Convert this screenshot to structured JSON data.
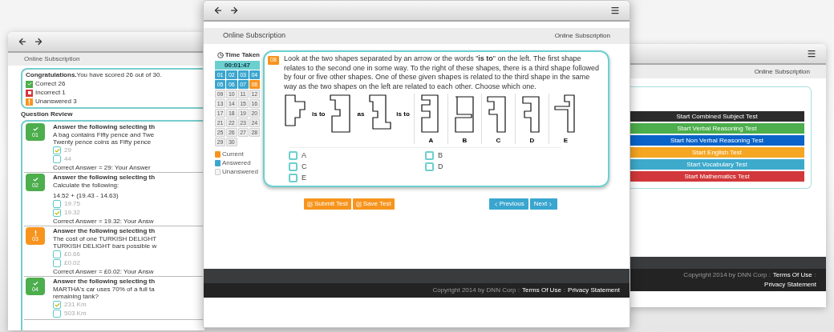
{
  "left_window": {
    "subheader": "Online Subscription",
    "result": {
      "message": "**Congratulations.**You have scored 26 out of 30.",
      "tallies": [
        {
          "kind": "correct",
          "label": "Correct 26"
        },
        {
          "kind": "incorrect",
          "label": "Incorrect 1"
        },
        {
          "kind": "unanswered",
          "label": "Unanswered 3"
        }
      ]
    },
    "review_title": "Question Review",
    "questions": [
      {
        "kind": "correct",
        "number": "01",
        "title": "Answer the following selecting th",
        "lines": [
          "A bag contains Fifty pence and Twe",
          "Twenty pence coins as Fifty pence"
        ],
        "options": [
          {
            "label": "29",
            "checked": true
          },
          {
            "label": "44",
            "checked": false
          }
        ],
        "answer": "Correct Answer = 29: Your Answer"
      },
      {
        "kind": "correct",
        "number": "02",
        "title": "Answer the following selecting th",
        "lines": [
          "Calculate the following:",
          "14.52 + (19.43 - 14.63)"
        ],
        "options": [
          {
            "label": "19.75",
            "checked": false
          },
          {
            "label": "19.32",
            "checked": true
          }
        ],
        "answer": "Correct Answer = 19.32: Your Answ"
      },
      {
        "kind": "unanswered",
        "number": "03",
        "title": "Answer the following selecting th",
        "lines": [
          "The cost of one TURKISH DELIGHT",
          "TURKISH DELIGHT bars possible w"
        ],
        "options": [
          {
            "label": "£0.66",
            "checked": false
          },
          {
            "label": "£0.02",
            "checked": false
          }
        ],
        "answer": "Correct Answer = £0.02: Your Answ"
      },
      {
        "kind": "correct",
        "number": "04",
        "title": "Answer the following selecting th",
        "lines": [
          "MARTHA's car uses 70% of a full ta",
          "remaining tank?"
        ],
        "options": [
          {
            "label": "231 Km",
            "checked": true
          },
          {
            "label": "503 Km",
            "checked": false
          }
        ]
      }
    ]
  },
  "main_window": {
    "subheader": "Online Subscription",
    "subheader_right": "Online Subscription",
    "timer": {
      "label": "Time Taken",
      "value": "00:01:47"
    },
    "question_nav": [
      {
        "number": "01",
        "answered": true,
        "current": false
      },
      {
        "number": "02",
        "answered": true,
        "current": false
      },
      {
        "number": "03",
        "answered": true,
        "current": false
      },
      {
        "number": "04",
        "answered": true,
        "current": false
      },
      {
        "number": "05",
        "answered": true,
        "current": false
      },
      {
        "number": "06",
        "answered": true,
        "current": false
      },
      {
        "number": "07",
        "answered": true,
        "current": false
      },
      {
        "number": "08",
        "answered": false,
        "current": true
      },
      {
        "number": "09",
        "answered": false,
        "current": false
      },
      {
        "number": "10",
        "answered": false,
        "current": false
      },
      {
        "number": "11",
        "answered": false,
        "current": false
      },
      {
        "number": "12",
        "answered": false,
        "current": false
      },
      {
        "number": "13",
        "answered": false,
        "current": false
      },
      {
        "number": "14",
        "answered": false,
        "current": false
      },
      {
        "number": "15",
        "answered": false,
        "current": false
      },
      {
        "number": "16",
        "answered": false,
        "current": false
      },
      {
        "number": "17",
        "answered": false,
        "current": false
      },
      {
        "number": "18",
        "answered": false,
        "current": false
      },
      {
        "number": "19",
        "answered": false,
        "current": false
      },
      {
        "number": "20",
        "answered": false,
        "current": false
      },
      {
        "number": "21",
        "answered": false,
        "current": false
      },
      {
        "number": "22",
        "answered": false,
        "current": false
      },
      {
        "number": "23",
        "answered": false,
        "current": false
      },
      {
        "number": "24",
        "answered": false,
        "current": false
      },
      {
        "number": "25",
        "answered": false,
        "current": false
      },
      {
        "number": "26",
        "answered": false,
        "current": false
      },
      {
        "number": "27",
        "answered": false,
        "current": false
      },
      {
        "number": "28",
        "answered": false,
        "current": false
      },
      {
        "number": "29",
        "answered": false,
        "current": false
      },
      {
        "number": "30",
        "answered": false,
        "current": false
      }
    ],
    "legend": [
      {
        "kind": "current",
        "label": "Current"
      },
      {
        "kind": "answered",
        "label": "Answered"
      },
      {
        "kind": "unanswered",
        "label": "Unanswered"
      }
    ],
    "question": {
      "number": "08",
      "text": "Look at the two shapes separated by an arrow or the words \"**is to**\" on the left. The first shape relates to the second one in some way. To the right of these shapes, there is a third shape followed by four or five other shapes. One of these given shapes is related to the third shape in the same way as the two shapes on the left are related to each other. Choose which one.",
      "connectors": [
        "is to",
        "as",
        "is to"
      ],
      "choices": [
        "A",
        "B",
        "C",
        "D",
        "E"
      ],
      "options": [
        {
          "label": "A",
          "checked": false
        },
        {
          "label": "B",
          "checked": false
        },
        {
          "label": "C",
          "checked": false
        },
        {
          "label": "D",
          "checked": false
        },
        {
          "label": "E",
          "checked": false
        }
      ]
    },
    "buttons": [
      {
        "kind": "submit",
        "label": "Submit Test"
      },
      {
        "kind": "save",
        "label": "Save Test"
      },
      {
        "kind": "previous",
        "label": "Previous"
      },
      {
        "kind": "next",
        "label": "Next"
      }
    ],
    "footer": [
      {
        "kind": "text",
        "label": "Copyright 2014 by DNN Corp :"
      },
      {
        "kind": "link",
        "label": "Terms Of Use"
      },
      {
        "kind": "text",
        "label": ":"
      },
      {
        "kind": "link",
        "label": "Privacy Statement"
      }
    ]
  },
  "right_window": {
    "subheader": "Online Subscription",
    "tests": [
      {
        "label": "Start Combined Subject Test",
        "color": "#2b2b2b"
      },
      {
        "label": "Start Verbal Reasoning Test",
        "color": "#4cae4c"
      },
      {
        "label": "Start Non Verbal Reasoning Test",
        "color": "#0a63c9"
      },
      {
        "label": "Start English Test",
        "color": "#f5a623"
      },
      {
        "label": "Start Vocabulary Test",
        "color": "#3eaacb"
      },
      {
        "label": "Start Mathematics Test",
        "color": "#d2383b"
      }
    ],
    "footer": [
      {
        "kind": "text",
        "label": "Copyright 2014 by DNN Corp :"
      },
      {
        "kind": "link",
        "label": "Terms Of Use"
      },
      {
        "kind": "text",
        "label": ":"
      },
      {
        "kind": "link",
        "label": "Privacy Statement"
      }
    ]
  }
}
